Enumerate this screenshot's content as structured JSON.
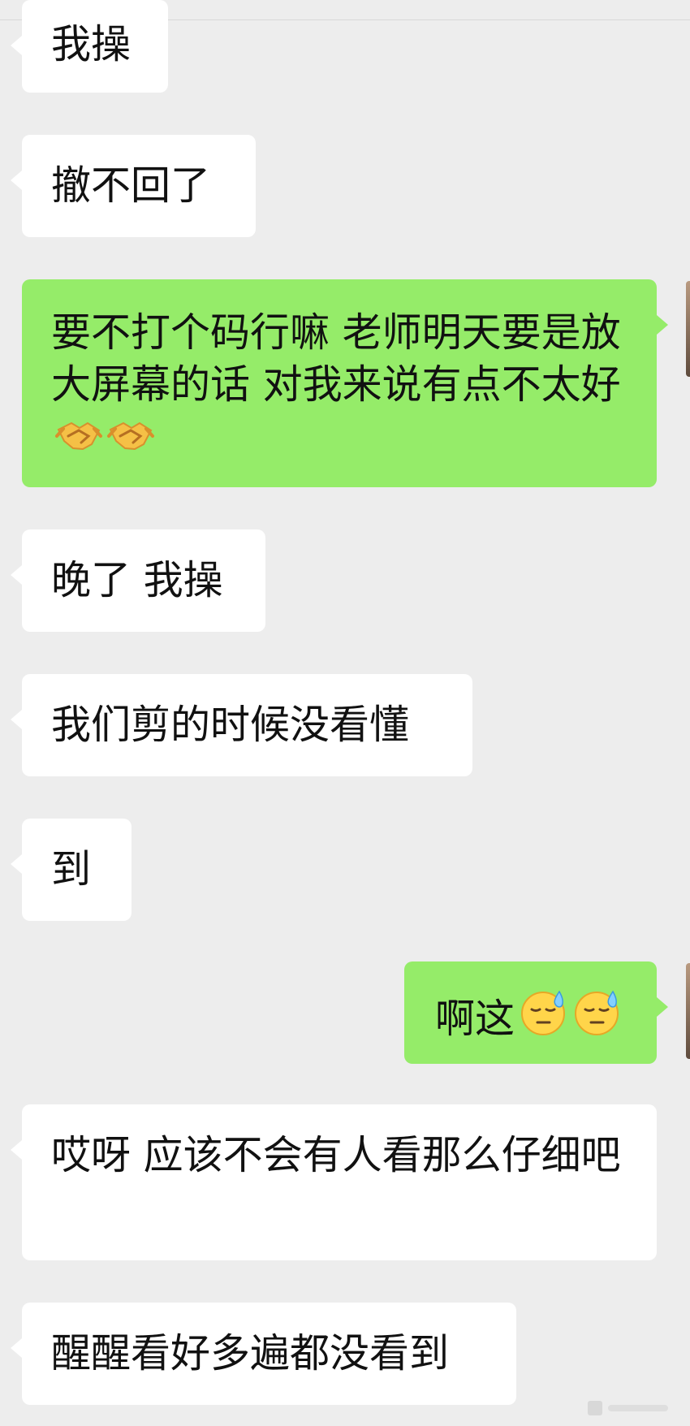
{
  "messages": [
    {
      "side": "received",
      "text": "我操"
    },
    {
      "side": "received",
      "text": "撤不回了"
    },
    {
      "side": "sent",
      "text": "要不打个码行嘛 老师明天要是放大屏幕的话 对我来说有点不太好",
      "emoji": [
        "handshake",
        "handshake"
      ]
    },
    {
      "side": "received",
      "text": "晚了 我操"
    },
    {
      "side": "received",
      "text": "我们剪的时候没看懂"
    },
    {
      "side": "received",
      "text": "到"
    },
    {
      "side": "sent",
      "text": "啊这",
      "emoji": [
        "downcast-sweat-face",
        "downcast-sweat-face"
      ]
    },
    {
      "side": "received",
      "text": "哎呀 应该不会有人看那么仔细吧"
    },
    {
      "side": "received",
      "text": "醒醒看好多遍都没看到"
    }
  ],
  "colors": {
    "background": "#ededed",
    "received_bubble": "#ffffff",
    "sent_bubble": "#95ec69"
  },
  "icons": {
    "handshake": "handshake-emoji",
    "downcast_sweat_face": "downcast-face-with-sweat-emoji",
    "avatar": "contact-avatar"
  }
}
